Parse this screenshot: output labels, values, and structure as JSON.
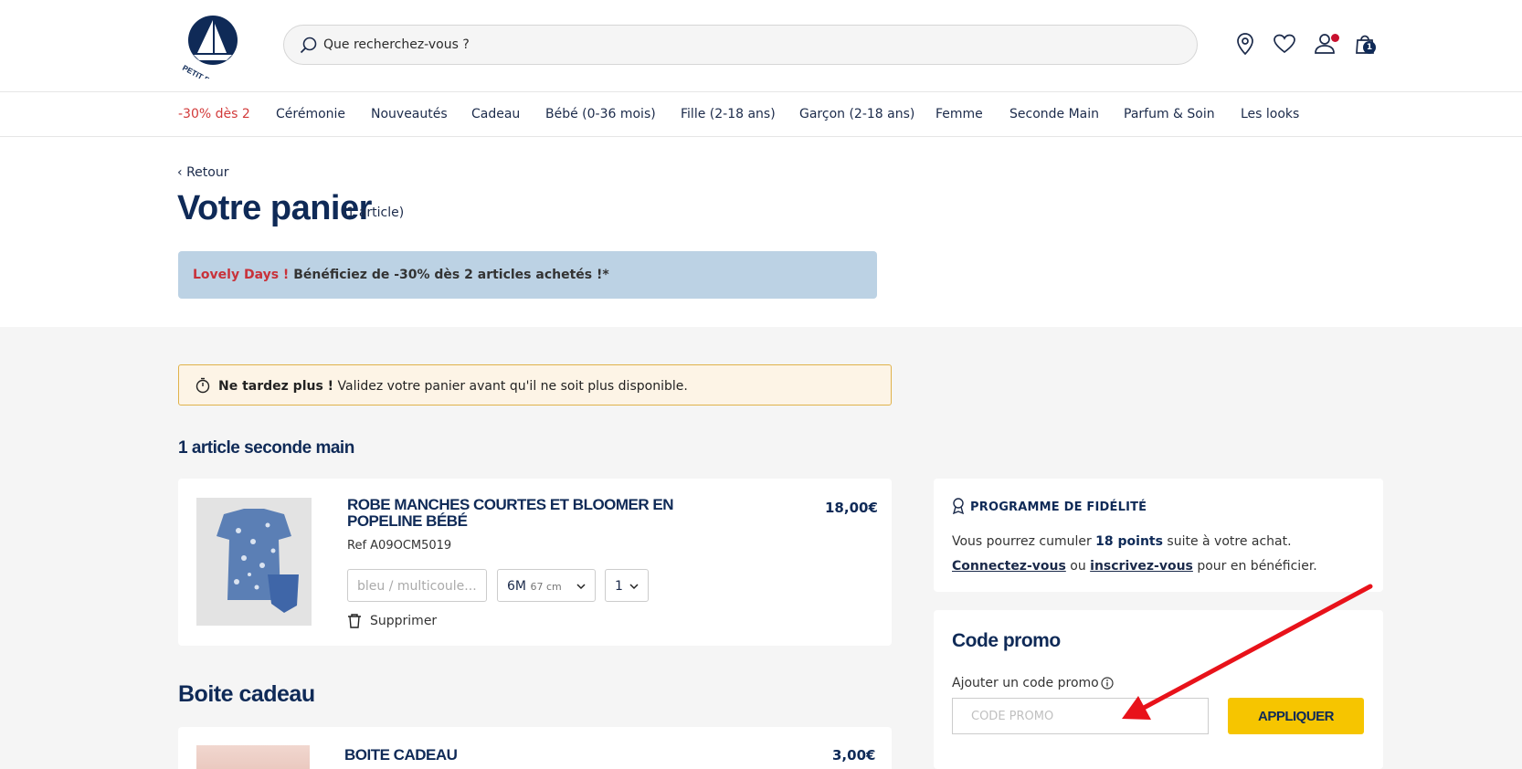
{
  "header": {
    "logo_text": "PETIT BATEAU",
    "search_placeholder": "Que recherchez-vous ?",
    "icons": [
      "location-icon",
      "heart-icon",
      "user-icon",
      "bag-icon"
    ],
    "cart_count": "1"
  },
  "nav": {
    "items": [
      {
        "label": "-30% dès 2"
      },
      {
        "label": "Cérémonie"
      },
      {
        "label": "Nouveautés"
      },
      {
        "label": "Cadeau"
      },
      {
        "label": "Bébé (0-36 mois)"
      },
      {
        "label": "Fille (2-18 ans)"
      },
      {
        "label": "Garçon (2-18 ans)"
      },
      {
        "label": "Femme"
      },
      {
        "label": "Seconde Main"
      },
      {
        "label": "Parfum & Soin"
      },
      {
        "label": "Les looks"
      }
    ]
  },
  "page": {
    "back": "Retour",
    "title": "Votre panier",
    "count": "(1 article)"
  },
  "banner": {
    "highlight": "Lovely Days !",
    "text": " Bénéficiez de -30% dès 2 articles achetés !*"
  },
  "warning": {
    "bold": "Ne tardez plus !",
    "text": " Validez votre panier avant qu'il ne soit plus disponible."
  },
  "second_hand": {
    "section_title": "1 article seconde main",
    "item": {
      "name": "ROBE MANCHES COURTES ET BLOOMER EN POPELINE BÉBÉ",
      "ref": "Ref A09OCM5019",
      "price": "18,00€",
      "color_placeholder": "bleu / multicoule...",
      "size": "6M",
      "size_detail": "67 cm",
      "quantity": "1",
      "delete": "Supprimer"
    }
  },
  "gift_box": {
    "section_title": "Boite cadeau",
    "item": {
      "name": "BOITE CADEAU",
      "price": "3,00€"
    }
  },
  "loyalty": {
    "title": "PROGRAMME DE FIDÉLITÉ",
    "line1_prefix": "Vous pourrez cumuler ",
    "line1_points": "18 points",
    "line1_suffix": " suite à votre achat.",
    "login_link": "Connectez-vous",
    "or": " ou ",
    "signup_link": "inscrivez-vous",
    "line2_suffix": " pour en bénéficier."
  },
  "promo": {
    "title": "Code promo",
    "label": "Ajouter un code promo",
    "placeholder": "CODE PROMO",
    "button": "APPLIQUER"
  },
  "colors": {
    "navy": "#0f2a57",
    "promo_red": "#d23a3a",
    "banner_blue": "#bcd2e4",
    "warning_bg": "#fdf4e6",
    "button_yellow": "#f6c500",
    "annotation_arrow": "#e8121a"
  }
}
